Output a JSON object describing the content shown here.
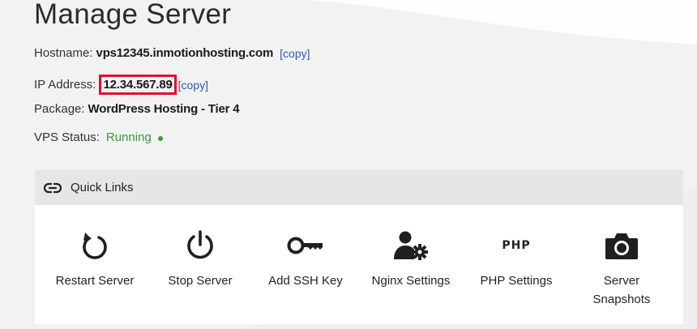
{
  "page": {
    "title": "Manage Server"
  },
  "server_info": {
    "hostname_label": "Hostname:",
    "hostname_value": "vps12345.inmotionhosting.com",
    "hostname_copy": "[copy]",
    "ip_label": "IP Address:",
    "ip_value": "12.34.567.89",
    "ip_copy": "[copy]",
    "package_label": "Package:",
    "package_value": "WordPress Hosting - Tier 4",
    "status_label": "VPS Status:",
    "status_value": "Running",
    "status_color": "#3c9a3c"
  },
  "quick_links": {
    "title": "Quick Links",
    "header_icon": "link-icon",
    "items": [
      {
        "label": "Restart Server",
        "icon": "restart-icon"
      },
      {
        "label": "Stop Server",
        "icon": "power-icon"
      },
      {
        "label": "Add SSH Key",
        "icon": "key-icon"
      },
      {
        "label": "Nginx Settings",
        "icon": "user-gear-icon"
      },
      {
        "label": "PHP Settings",
        "icon": "php-icon",
        "icon_text": "PHP"
      },
      {
        "label": "Server Snapshots",
        "icon": "camera-icon"
      }
    ]
  },
  "colors": {
    "highlight_border": "#e0102a",
    "link": "#2a5db0",
    "header_bg": "#e6e6e6"
  }
}
